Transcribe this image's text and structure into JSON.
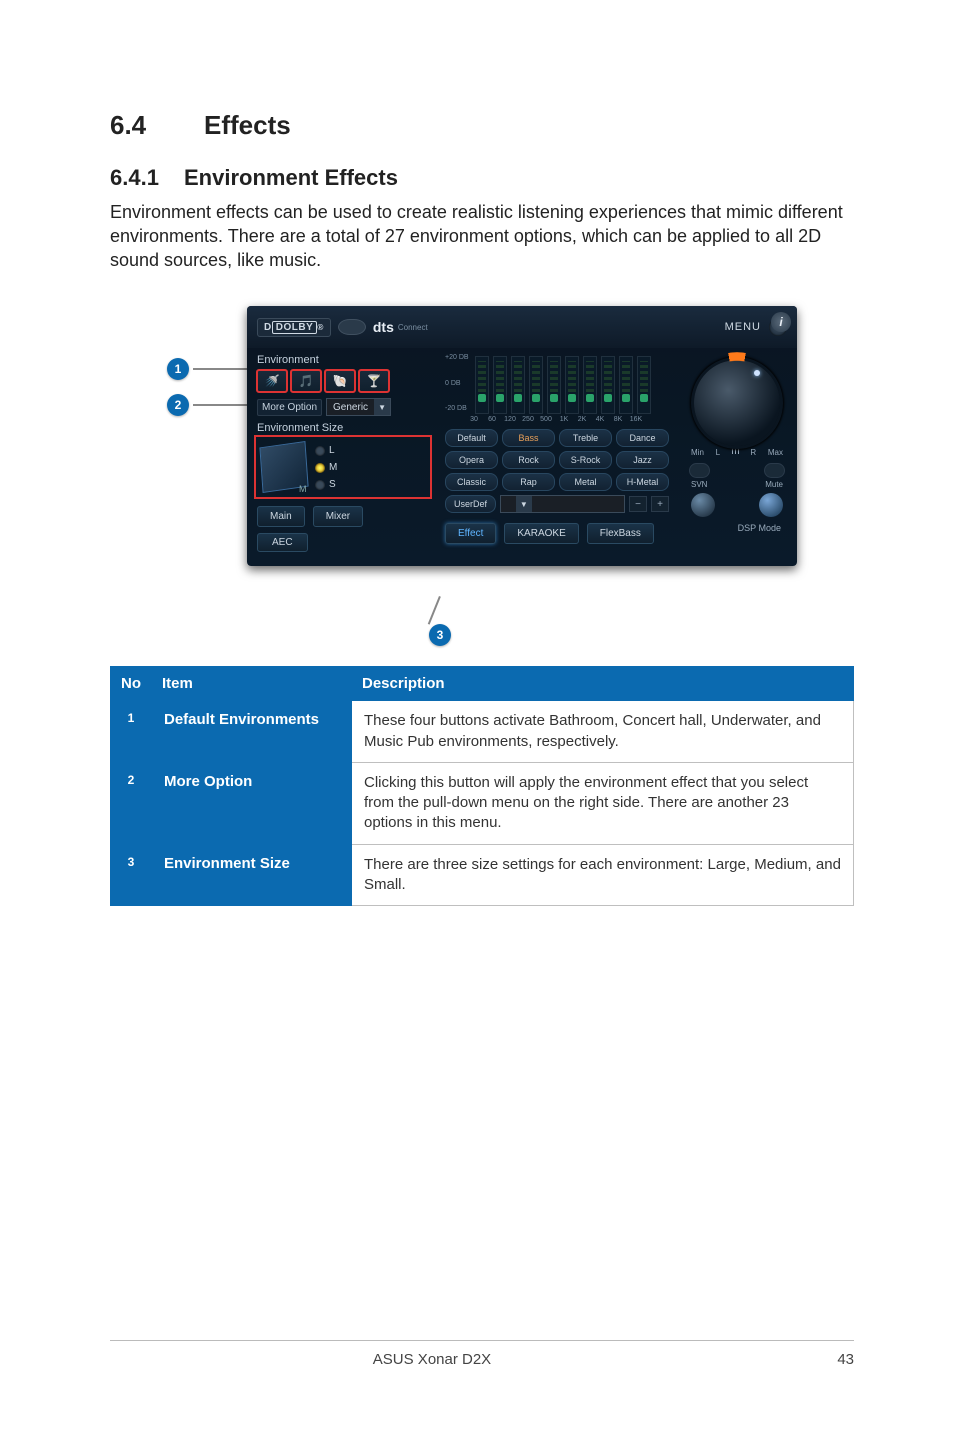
{
  "section": {
    "num": "6.4",
    "title": "Effects"
  },
  "subsection": {
    "num": "6.4.1",
    "title": "Environment Effects"
  },
  "paragraph": "Environment effects can be used to create realistic listening experiences that mimic different environments. There are a total of 27 environment options, which can be applied to all 2D sound sources, like music.",
  "callouts": {
    "c1": "1",
    "c2": "2",
    "c3": "3"
  },
  "table": {
    "headers": {
      "no": "No",
      "item": "Item",
      "desc": "Description"
    },
    "rows": [
      {
        "n": "1",
        "item": "Default Environments",
        "desc": "These four buttons activate Bathroom, Concert hall, Underwater, and Music Pub environments, respectively."
      },
      {
        "n": "2",
        "item": "More Option",
        "desc": "Clicking this button will apply the environment effect that you select from the pull-down menu on the right side. There are another 23 options in this menu."
      },
      {
        "n": "3",
        "item": "Environment Size",
        "desc": "There are three size settings for each environment: Large, Medium, and Small."
      }
    ]
  },
  "ui": {
    "brand_dolby_prefix": "D",
    "brand_dolby_box": "DOLBY",
    "brand_reg": "®",
    "brand_dts": "dts",
    "brand_connect": "Connect",
    "menu": "MENU",
    "info": "i",
    "env_label": "Environment",
    "more_option_btn": "More Option",
    "more_option_value": "Generic",
    "env_size_label": "Environment Size",
    "size_L": "L",
    "size_M": "M",
    "size_S": "S",
    "eq_scale": {
      "top": "+20\nDB",
      "mid": "0\nDB",
      "bot": "-20\nDB"
    },
    "freqs": [
      "30",
      "60",
      "120",
      "250",
      "500",
      "1K",
      "2K",
      "4K",
      "8K",
      "16K"
    ],
    "presets": [
      "Default",
      "Bass",
      "Treble",
      "Dance",
      "Opera",
      "Rock",
      "S-Rock",
      "Jazz",
      "Classic",
      "Rap",
      "Metal",
      "H-Metal"
    ],
    "userdef": "UserDef",
    "tabs_row1": [
      "Main",
      "Mixer",
      "Effect",
      "KARAOKE",
      "FlexBass"
    ],
    "tabs_row2": [
      "AEC"
    ],
    "vol_min": "Min",
    "vol_max": "Max",
    "vol_L": "L",
    "vol_R": "R",
    "svn": "SVN",
    "mute": "Mute",
    "dsp": "DSP Mode",
    "m_label": "M"
  },
  "footer": {
    "product": "ASUS Xonar D2X",
    "page": "43"
  }
}
